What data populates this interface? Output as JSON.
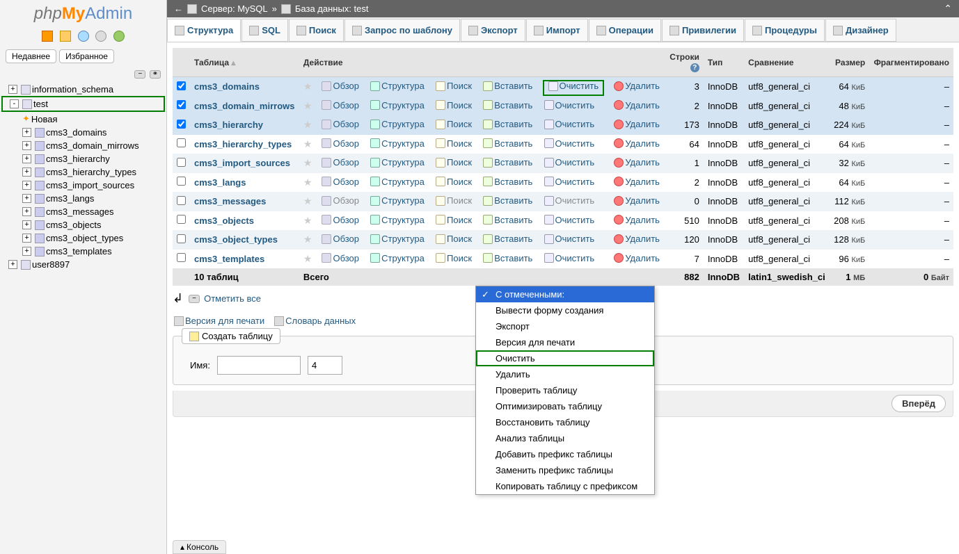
{
  "logo": {
    "php": "php",
    "my": "My",
    "admin": "Admin"
  },
  "sidebar": {
    "recent_label": "Недавнее",
    "favorite_label": "Избранное",
    "toolbar_icons": [
      "home-icon",
      "logout-icon",
      "docs-icon",
      "settings-icon",
      "reload-icon"
    ]
  },
  "tree": [
    {
      "name": "information_schema",
      "type": "db",
      "level": 1,
      "exp": "+"
    },
    {
      "name": "test",
      "type": "db",
      "level": 1,
      "exp": "-",
      "hl": true,
      "children": [
        {
          "name": "Новая",
          "type": "new",
          "level": 2
        },
        {
          "name": "cms3_domains",
          "type": "tbl",
          "level": 2
        },
        {
          "name": "cms3_domain_mirrows",
          "type": "tbl",
          "level": 2
        },
        {
          "name": "cms3_hierarchy",
          "type": "tbl",
          "level": 2
        },
        {
          "name": "cms3_hierarchy_types",
          "type": "tbl",
          "level": 2
        },
        {
          "name": "cms3_import_sources",
          "type": "tbl",
          "level": 2
        },
        {
          "name": "cms3_langs",
          "type": "tbl",
          "level": 2
        },
        {
          "name": "cms3_messages",
          "type": "tbl",
          "level": 2
        },
        {
          "name": "cms3_objects",
          "type": "tbl",
          "level": 2
        },
        {
          "name": "cms3_object_types",
          "type": "tbl",
          "level": 2
        },
        {
          "name": "cms3_templates",
          "type": "tbl",
          "level": 2
        }
      ]
    },
    {
      "name": "user8897",
      "type": "db",
      "level": 1,
      "exp": "+"
    }
  ],
  "breadcrumb": {
    "server_label": "Сервер: MySQL",
    "db_label": "База данных: test",
    "sep": "»"
  },
  "tabs": [
    {
      "label": "Структура",
      "active": true,
      "icon": "structure-icon"
    },
    {
      "label": "SQL",
      "icon": "sql-icon"
    },
    {
      "label": "Поиск",
      "icon": "search-icon"
    },
    {
      "label": "Запрос по шаблону",
      "icon": "query-icon"
    },
    {
      "label": "Экспорт",
      "icon": "export-icon"
    },
    {
      "label": "Импорт",
      "icon": "import-icon"
    },
    {
      "label": "Операции",
      "icon": "operations-icon"
    },
    {
      "label": "Привилегии",
      "icon": "privileges-icon"
    },
    {
      "label": "Процедуры",
      "icon": "routines-icon"
    },
    {
      "label": "Дизайнер",
      "icon": "designer-icon"
    }
  ],
  "table": {
    "headers": {
      "table": "Таблица",
      "action": "Действие",
      "rows": "Строки",
      "type": "Тип",
      "collation": "Сравнение",
      "size": "Размер",
      "overhead": "Фрагментировано"
    },
    "actions": {
      "browse": "Обзор",
      "structure": "Структура",
      "search": "Поиск",
      "insert": "Вставить",
      "empty": "Очистить",
      "drop": "Удалить"
    },
    "rows": [
      {
        "name": "cms3_domains",
        "sel": true,
        "rows": 3,
        "type": "InnoDB",
        "coll": "utf8_general_ci",
        "size": "64",
        "unit": "КиБ",
        "frag": "–",
        "hl_empty": true
      },
      {
        "name": "cms3_domain_mirrows",
        "sel": true,
        "rows": 2,
        "type": "InnoDB",
        "coll": "utf8_general_ci",
        "size": "48",
        "unit": "КиБ",
        "frag": "–"
      },
      {
        "name": "cms3_hierarchy",
        "sel": true,
        "rows": 173,
        "type": "InnoDB",
        "coll": "utf8_general_ci",
        "size": "224",
        "unit": "КиБ",
        "frag": "–"
      },
      {
        "name": "cms3_hierarchy_types",
        "sel": false,
        "rows": 64,
        "type": "InnoDB",
        "coll": "utf8_general_ci",
        "size": "64",
        "unit": "КиБ",
        "frag": "–"
      },
      {
        "name": "cms3_import_sources",
        "sel": false,
        "rows": 1,
        "type": "InnoDB",
        "coll": "utf8_general_ci",
        "size": "32",
        "unit": "КиБ",
        "frag": "–"
      },
      {
        "name": "cms3_langs",
        "sel": false,
        "rows": 2,
        "type": "InnoDB",
        "coll": "utf8_general_ci",
        "size": "64",
        "unit": "КиБ",
        "frag": "–"
      },
      {
        "name": "cms3_messages",
        "sel": false,
        "rows": 0,
        "type": "InnoDB",
        "coll": "utf8_general_ci",
        "size": "112",
        "unit": "КиБ",
        "frag": "–",
        "muted": true
      },
      {
        "name": "cms3_objects",
        "sel": false,
        "rows": 510,
        "type": "InnoDB",
        "coll": "utf8_general_ci",
        "size": "208",
        "unit": "КиБ",
        "frag": "–"
      },
      {
        "name": "cms3_object_types",
        "sel": false,
        "rows": 120,
        "type": "InnoDB",
        "coll": "utf8_general_ci",
        "size": "128",
        "unit": "КиБ",
        "frag": "–"
      },
      {
        "name": "cms3_templates",
        "sel": false,
        "rows": 7,
        "type": "InnoDB",
        "coll": "utf8_general_ci",
        "size": "96",
        "unit": "КиБ",
        "frag": "–"
      }
    ],
    "totals": {
      "count_label": "10 таблиц",
      "total_label": "Всего",
      "rows": 882,
      "type": "InnoDB",
      "coll": "latin1_swedish_ci",
      "size": "1",
      "unit": "МБ",
      "frag_n": "0",
      "frag_unit": "Байт"
    }
  },
  "checkall": {
    "label": "Отметить все"
  },
  "dropdown": {
    "options": [
      {
        "label": "С отмеченными:",
        "selected": true
      },
      {
        "label": "Вывести форму создания"
      },
      {
        "label": "Экспорт"
      },
      {
        "label": "Версия для печати"
      },
      {
        "label": "Очистить",
        "hl": true
      },
      {
        "label": "Удалить"
      },
      {
        "label": "Проверить таблицу"
      },
      {
        "label": "Оптимизировать таблицу"
      },
      {
        "label": "Восстановить таблицу"
      },
      {
        "label": "Анализ таблицы"
      },
      {
        "label": "Добавить префикс таблицы"
      },
      {
        "label": "Заменить префикс таблицы"
      },
      {
        "label": "Копировать таблицу с префиксом"
      }
    ]
  },
  "links": {
    "print": "Версия для печати",
    "dict": "Словарь данных"
  },
  "create": {
    "legend": "Создать таблицу",
    "name_label": "Имя:",
    "cols_value": "4",
    "submit": "Вперёд"
  },
  "console": "Консоль"
}
